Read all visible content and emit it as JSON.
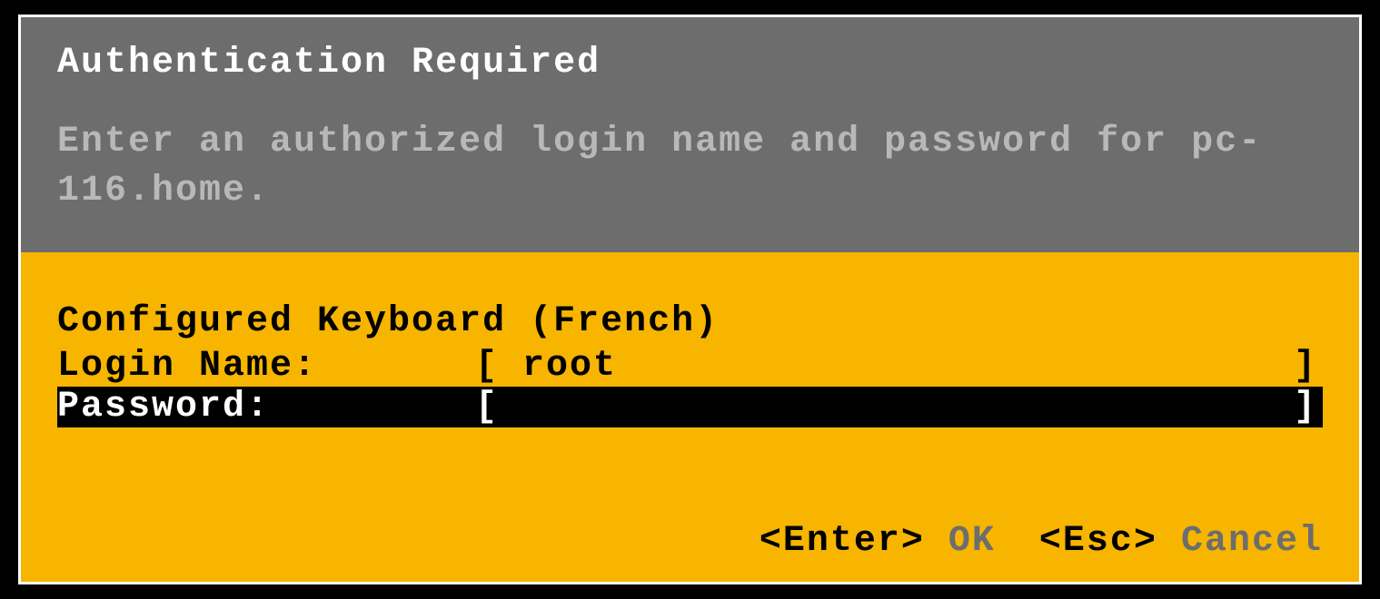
{
  "dialog": {
    "title": "Authentication Required",
    "subtitle": "Enter an authorized login name and password for pc-116.home."
  },
  "form": {
    "keyboard_line": "Configured Keyboard (French)",
    "login_label": "Login Name:",
    "login_value": "root",
    "password_label": "Password:",
    "password_value": ""
  },
  "footer": {
    "ok_key": "<Enter>",
    "ok_label": "OK",
    "cancel_key": "<Esc>",
    "cancel_label": "Cancel"
  }
}
